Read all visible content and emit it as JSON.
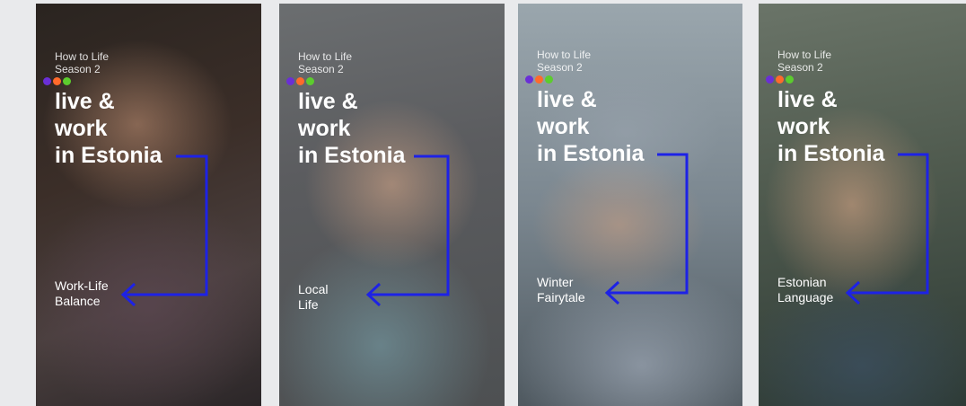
{
  "posters": [
    {
      "series_line1": "How to Life",
      "series_line2": "Season 2",
      "title": "live &\nwork\nin Estonia",
      "topic": "Work-Life\nBalance"
    },
    {
      "series_line1": "How to Life",
      "series_line2": "Season 2",
      "title": "live &\nwork\nin Estonia",
      "topic": "Local\nLife"
    },
    {
      "series_line1": "How to Life",
      "series_line2": "Season 2",
      "title": "live &\nwork\nin Estonia",
      "topic": "Winter\nFairytale"
    },
    {
      "series_line1": "How to Life",
      "series_line2": "Season 2",
      "title": "live &\nwork\nin Estonia",
      "topic": "Estonian\nLanguage"
    }
  ],
  "colors": {
    "arrow": "#1d22e6",
    "dot_purple": "#6a2fd6",
    "dot_orange": "#ff6a2b",
    "dot_green": "#5ccc2e"
  }
}
